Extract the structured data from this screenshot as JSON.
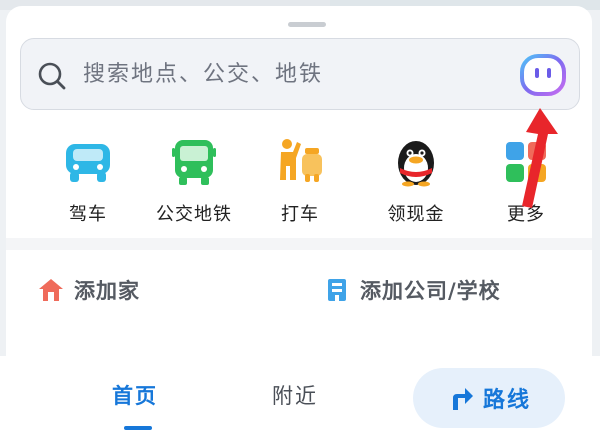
{
  "search": {
    "placeholder": "搜索地点、公交、地铁"
  },
  "quick_actions": [
    {
      "label": "驾车",
      "icon": "car-icon"
    },
    {
      "label": "公交地铁",
      "icon": "bus-icon"
    },
    {
      "label": "打车",
      "icon": "taxi-hail-icon"
    },
    {
      "label": "领现金",
      "icon": "penguin-icon"
    },
    {
      "label": "更多",
      "icon": "grid-more-icon"
    }
  ],
  "places": {
    "home": "添加家",
    "company": "添加公司/学校"
  },
  "tabs": {
    "home": "首页",
    "nearby": "附近",
    "route": "路线"
  },
  "colors": {
    "accent": "#1677d9",
    "car": "#2eb7e6",
    "bus": "#2fbf5b",
    "taxi": "#f5a623",
    "home_icon": "#ef6b5b",
    "company_icon": "#3fa3e8",
    "annotation_arrow": "#e8262b"
  }
}
